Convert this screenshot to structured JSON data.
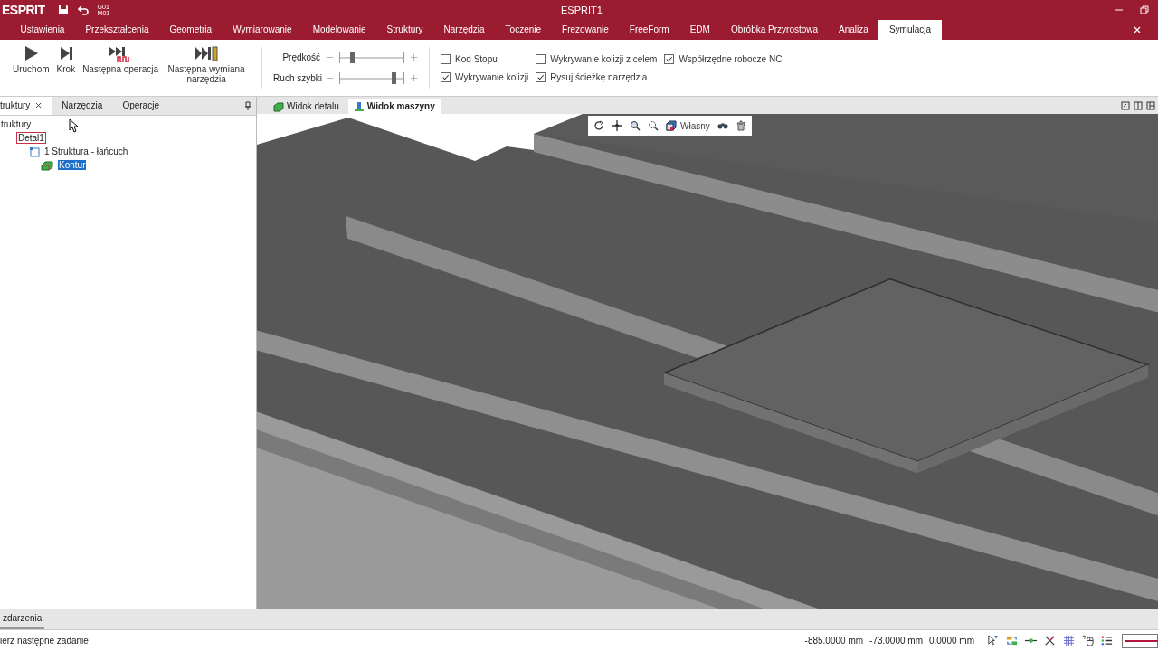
{
  "window": {
    "logo": "ESPRIT",
    "title": "ESPRIT1",
    "codes": [
      "G01",
      "M01"
    ]
  },
  "ribbon_tabs": [
    {
      "label": "Ustawienia",
      "selected": false
    },
    {
      "label": "Przekształcenia",
      "selected": false
    },
    {
      "label": "Geometria",
      "selected": false
    },
    {
      "label": "Wymiarowanie",
      "selected": false
    },
    {
      "label": "Modelowanie",
      "selected": false
    },
    {
      "label": "Struktury",
      "selected": false
    },
    {
      "label": "Narzędzia",
      "selected": false
    },
    {
      "label": "Toczenie",
      "selected": false
    },
    {
      "label": "Frezowanie",
      "selected": false
    },
    {
      "label": "FreeForm",
      "selected": false
    },
    {
      "label": "EDM",
      "selected": false
    },
    {
      "label": "Obróbka Przyrostowa",
      "selected": false
    },
    {
      "label": "Analiza",
      "selected": false
    },
    {
      "label": "Symulacja",
      "selected": true
    }
  ],
  "ribbon": {
    "buttons": [
      {
        "kind": "play",
        "label": "Uruchom"
      },
      {
        "kind": "step",
        "label": "Krok"
      },
      {
        "kind": "next-op",
        "label": "Następna operacja"
      },
      {
        "kind": "next-tool",
        "label": "Następna wymiana narzędzia"
      }
    ],
    "sliders": [
      {
        "label": "Prędkość",
        "level": 0.2
      },
      {
        "label": "Ruch szybki",
        "level": 0.85
      }
    ],
    "checkboxes": [
      {
        "label": "Kod Stopu",
        "checked": false
      },
      {
        "label": "Wykrywanie kolizji",
        "checked": true
      },
      {
        "label": "Wykrywanie kolizji z celem",
        "checked": false
      },
      {
        "label": "Rysuj ścieżkę narzędzia",
        "checked": true
      },
      {
        "label": "Współrzędne robocze NC",
        "checked": true
      }
    ]
  },
  "left_panel": {
    "tabs": [
      {
        "label": "truktury",
        "selected": true
      },
      {
        "label": "Narzędzia",
        "selected": false
      },
      {
        "label": "Operacje",
        "selected": false
      }
    ],
    "tree": [
      {
        "label": "truktury",
        "selected": false,
        "children": [
          {
            "label": "Detal1",
            "selected": false,
            "children": [
              {
                "label": "1 Struktura - łańcuch",
                "selected": false,
                "children": [
                  {
                    "label": "Kontur",
                    "selected": true
                  }
                ]
              }
            ]
          }
        ]
      }
    ]
  },
  "view_tabs": [
    {
      "label": "Widok detalu",
      "selected": false
    },
    {
      "label": "Widok maszyny",
      "selected": true
    }
  ],
  "view_toolbar": {
    "view_label": "Własny"
  },
  "bottom_tabs": [
    {
      "label": "zdarzenia",
      "selected": true
    }
  ],
  "status_bar": {
    "message": "ierz następne zadanie",
    "coords": [
      "-885.0000 mm",
      "-73.0000 mm",
      "0.0000 mm"
    ]
  }
}
